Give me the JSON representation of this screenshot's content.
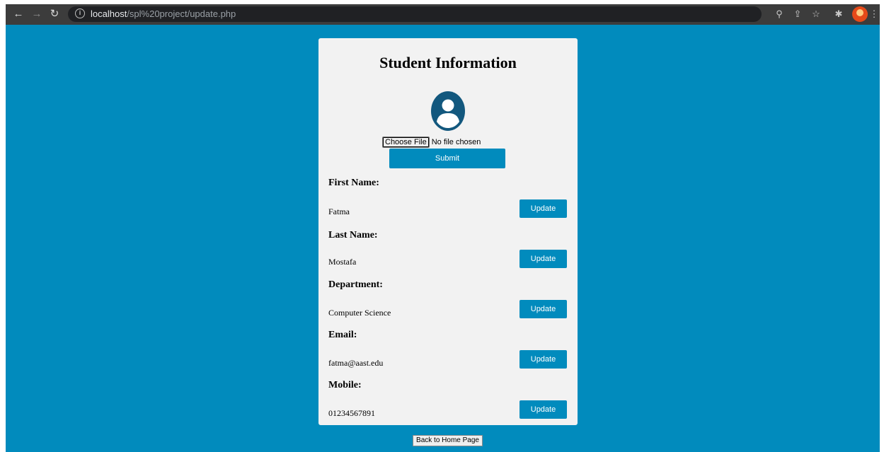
{
  "browser": {
    "url_host": "localhost",
    "url_path": "/spl%20project/update.php"
  },
  "card": {
    "title": "Student Information",
    "choose_file_label": "Choose File",
    "no_file_text": "No file chosen",
    "submit_label": "Submit",
    "update_label": "Update",
    "fields": [
      {
        "label": "First Name:",
        "value": "Fatma"
      },
      {
        "label": "Last Name:",
        "value": "Mostafa"
      },
      {
        "label": "Department:",
        "value": "Computer Science"
      },
      {
        "label": "Email:",
        "value": "fatma@aast.edu"
      },
      {
        "label": "Mobile:",
        "value": "01234567891"
      }
    ]
  },
  "back_button_label": "Back to Home Page",
  "colors": {
    "page_background": "#018bbd",
    "card_background": "#f2f2f2",
    "button_accent": "#018bbd",
    "avatar": "#13587e"
  }
}
